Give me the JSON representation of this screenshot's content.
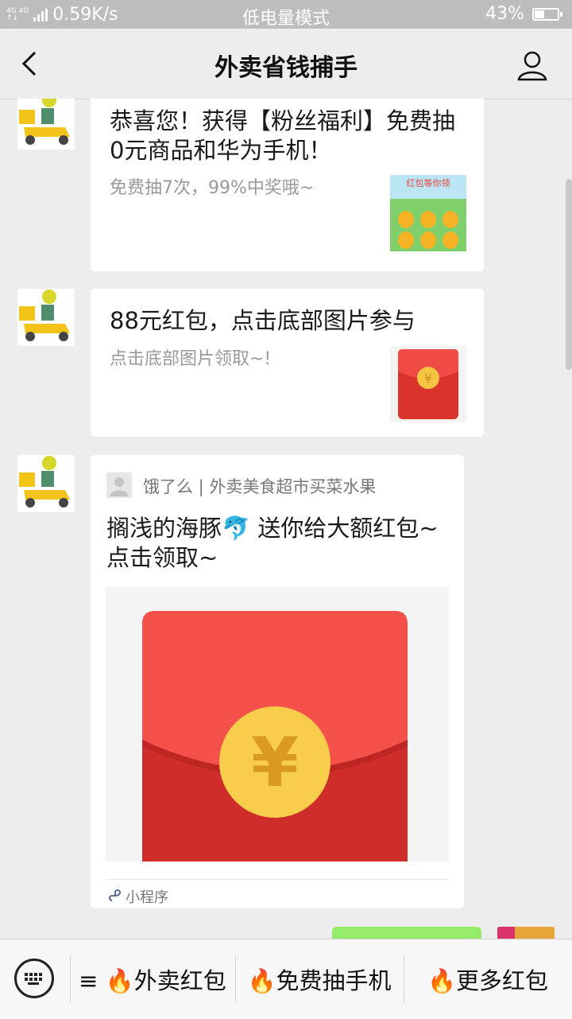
{
  "status_bar": {
    "network_small_top": "4G 4G",
    "network_small_bottom": "↑↓",
    "speed": "0.59K/s",
    "mode": "低电量模式",
    "battery_pct": "43%",
    "battery_level": 0.43
  },
  "nav": {
    "title": "外卖省钱捕手"
  },
  "messages": [
    {
      "title": "恭喜您！获得【粉丝福利】免费抽0元商品和华为手机！",
      "desc": "免费抽7次，99%中奖哦~",
      "thumb_caption": "红包等你领"
    },
    {
      "title": "88元红包，点击底部图片参与",
      "desc": "点击底部图片领取~!"
    },
    {
      "source": "饿了么 | 外卖美食超市买菜水果",
      "title": "搁浅的海豚🐬 送你给大额红包~点击领取~",
      "miniprogram": "小程序"
    }
  ],
  "bottom_menu": {
    "items": [
      "≡ 🔥外卖红包",
      "🔥免费抽手机",
      "🔥更多红包"
    ]
  },
  "colors": {
    "red_packet": "#e8443b",
    "coin": "#f5c542",
    "sent_bubble": "#95ec69"
  }
}
